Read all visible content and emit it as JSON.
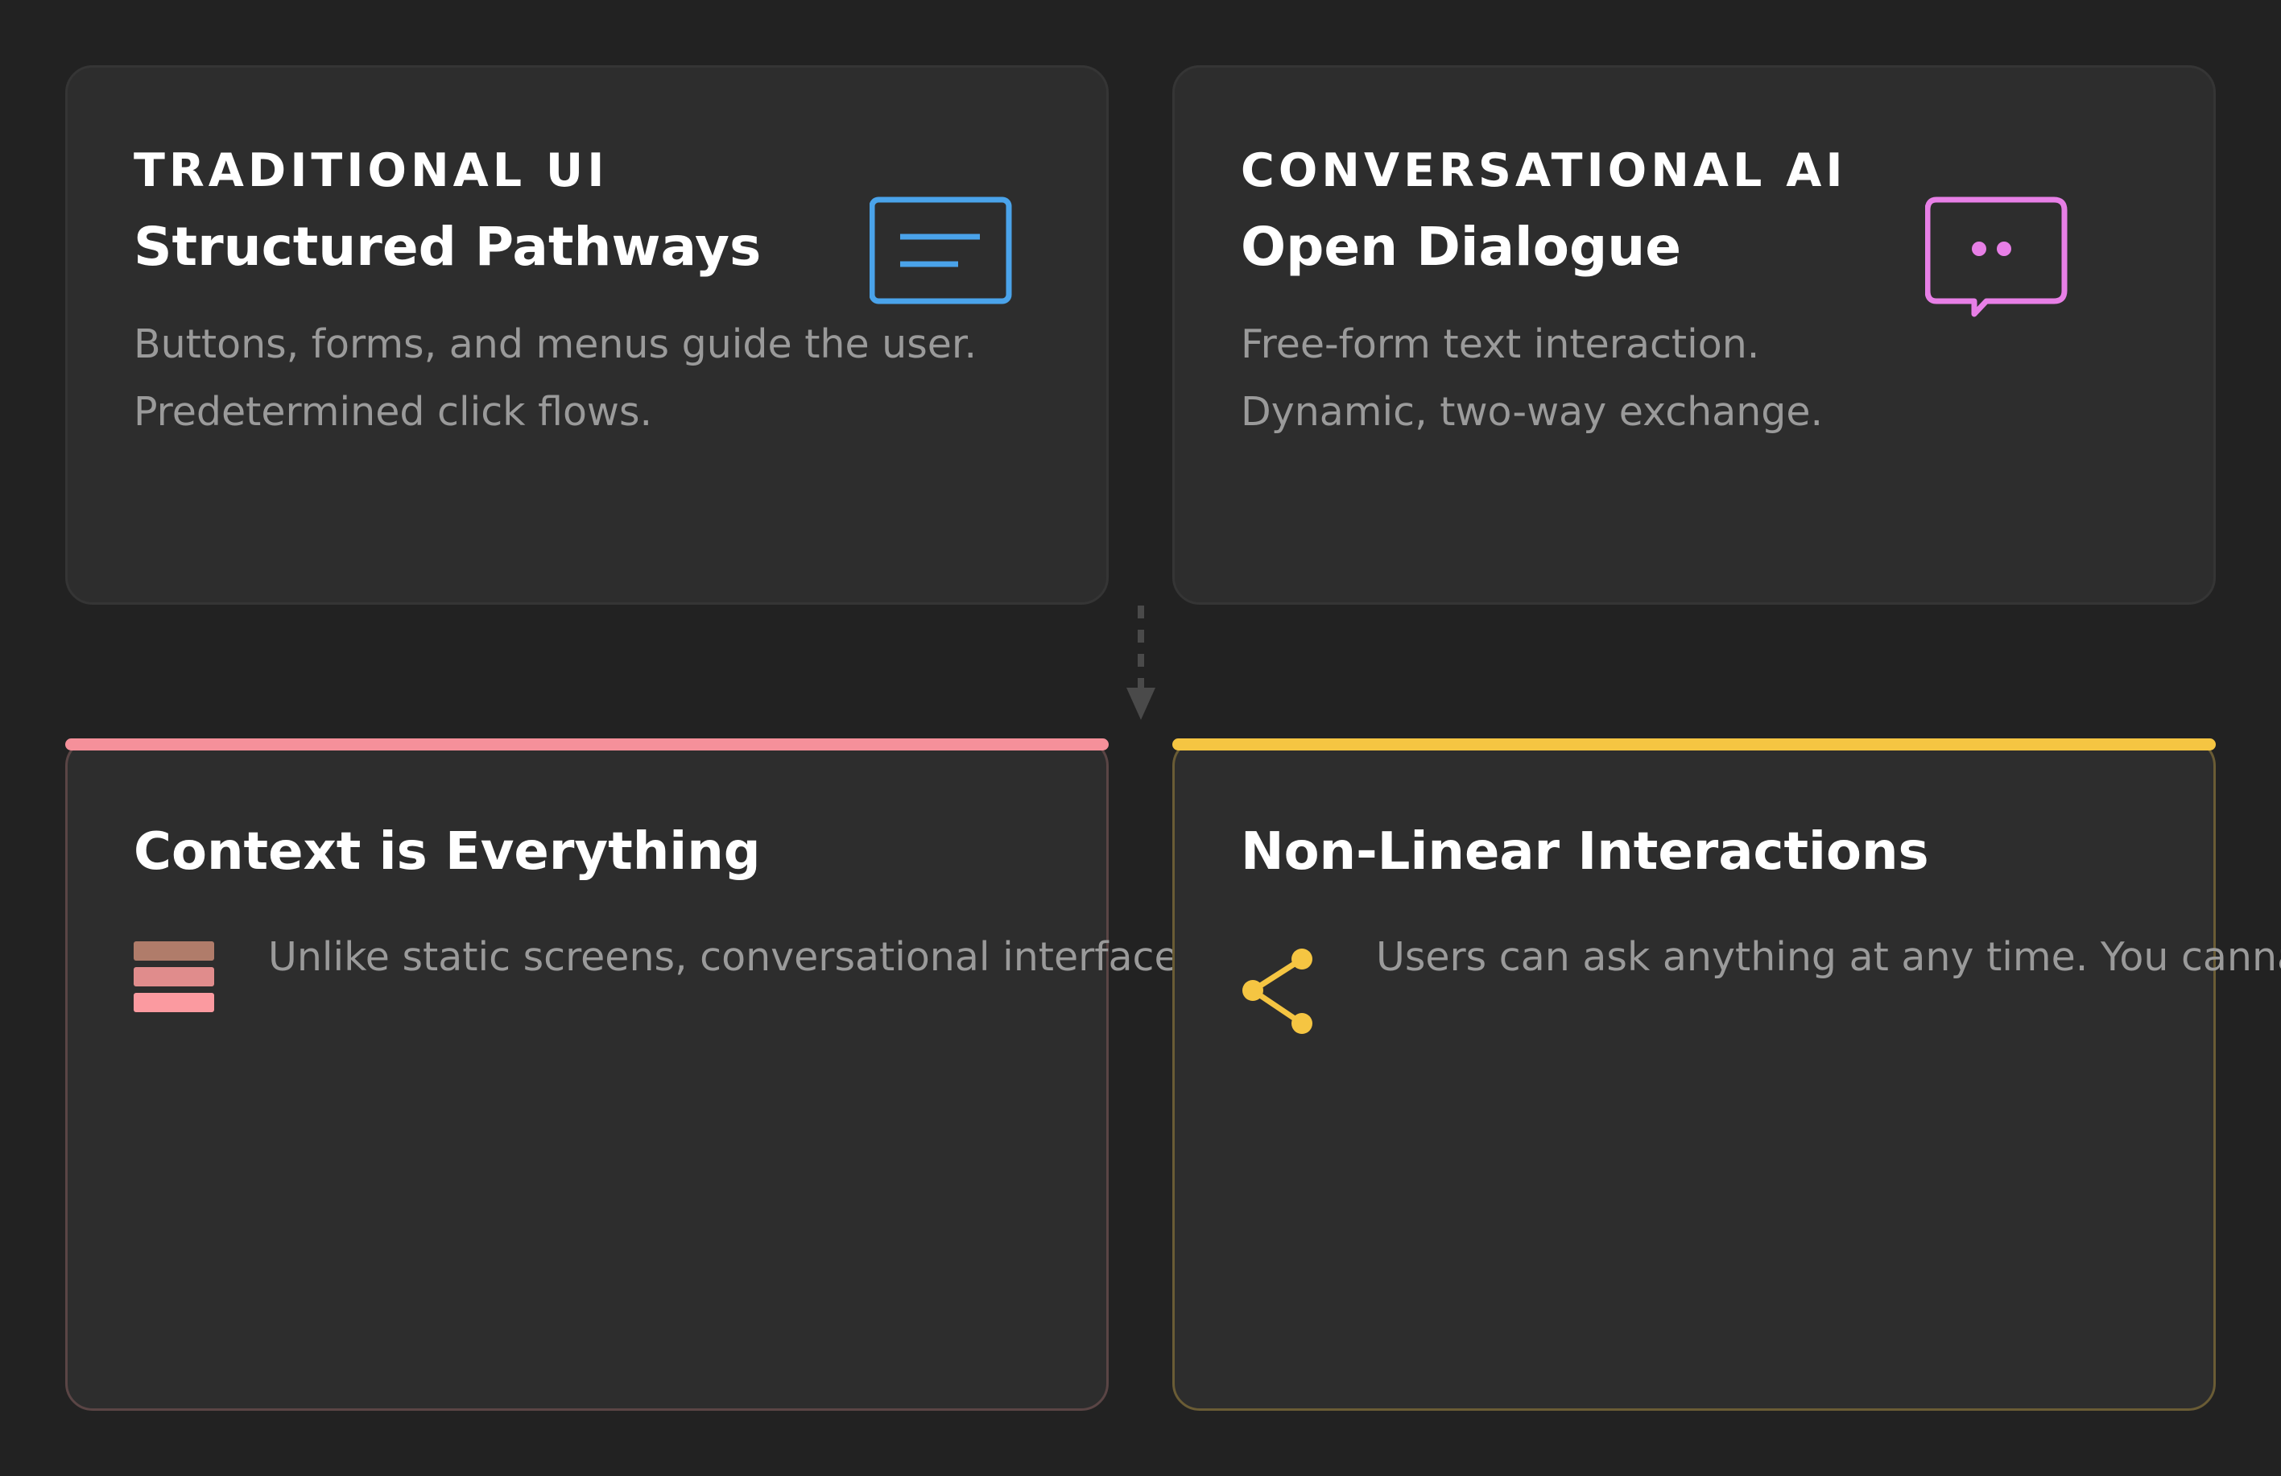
{
  "colors": {
    "background": "#222222",
    "card": "#2d2d2d",
    "blue_accent": "#4aa3ea",
    "pink_accent": "#e77fe6",
    "red_accent": "#f5909a",
    "yellow_accent": "#f5c542",
    "muted_text": "#9a9a9a"
  },
  "traditional": {
    "kicker": "TRADITIONAL UI",
    "title": "Structured Pathways",
    "lines": [
      "Buttons, forms, and menus guide the user.",
      "Predetermined click flows."
    ],
    "icon": "text-window-icon"
  },
  "conversational": {
    "kicker": "CONVERSATIONAL AI",
    "title": "Open Dialogue",
    "lines": [
      "Free-form text interaction.",
      "Dynamic, two-way exchange."
    ],
    "icon": "chat-bubble-icon"
  },
  "context": {
    "title": "Context is Everything",
    "text": "Unlike static screens, conversational interfaces r",
    "icon": "stack-layers-icon"
  },
  "nonlinear": {
    "title": "Non-Linear Interactions",
    "text": "Users can ask anything at any time. You cannati",
    "icon": "share-nodes-icon"
  }
}
